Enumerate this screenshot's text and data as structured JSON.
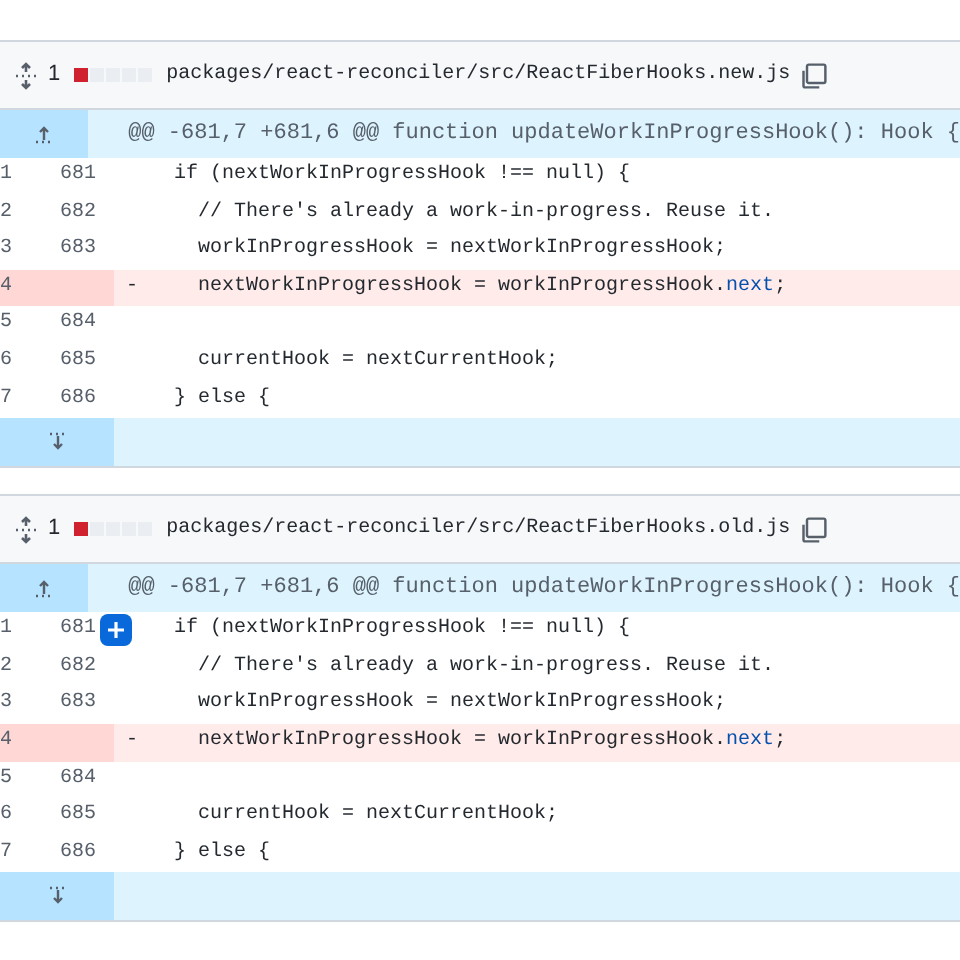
{
  "files": [
    {
      "count": "1",
      "diffstat": [
        {
          "kind": "deleted"
        },
        {
          "kind": "neutral"
        },
        {
          "kind": "neutral"
        },
        {
          "kind": "neutral"
        },
        {
          "kind": "neutral"
        }
      ],
      "path": "packages/react-reconciler/src/ReactFiberHooks.new.js",
      "hunk_header": "@@ -681,7 +681,6 @@ function updateWorkInProgressHook(): Hook {",
      "lines": [
        {
          "kind": "context",
          "old": "1",
          "new": "681",
          "segments": [
            {
              "kind": "plain",
              "text": "  if (nextWorkInProgressHook !== null) {"
            }
          ]
        },
        {
          "kind": "context",
          "old": "2",
          "new": "682",
          "segments": [
            {
              "kind": "plain",
              "text": "    // There's already a work-in-progress. Reuse it."
            }
          ]
        },
        {
          "kind": "context",
          "old": "3",
          "new": "683",
          "segments": [
            {
              "kind": "plain",
              "text": "    workInProgressHook = nextWorkInProgressHook;"
            }
          ]
        },
        {
          "kind": "deleted",
          "old": "4",
          "sign": "-",
          "segments": [
            {
              "kind": "plain",
              "text": "    nextWorkInProgressHook = workInProgressHook."
            },
            {
              "kind": "property",
              "text": "next"
            },
            {
              "kind": "plain",
              "text": ";"
            }
          ]
        },
        {
          "kind": "context",
          "old": "5",
          "new": "684"
        },
        {
          "kind": "context",
          "old": "6",
          "new": "685",
          "segments": [
            {
              "kind": "plain",
              "text": "    currentHook = nextCurrentHook;"
            }
          ]
        },
        {
          "kind": "context",
          "old": "7",
          "new": "686",
          "segments": [
            {
              "kind": "plain",
              "text": "  } else {"
            }
          ]
        }
      ]
    },
    {
      "count": "1",
      "diffstat": [
        {
          "kind": "deleted"
        },
        {
          "kind": "neutral"
        },
        {
          "kind": "neutral"
        },
        {
          "kind": "neutral"
        },
        {
          "kind": "neutral"
        }
      ],
      "path": "packages/react-reconciler/src/ReactFiberHooks.old.js",
      "hunk_header": "@@ -681,7 +681,6 @@ function updateWorkInProgressHook(): Hook {",
      "lines": [
        {
          "kind": "context",
          "old": "1",
          "new": "681",
          "comment_button": true,
          "segments": [
            {
              "kind": "plain",
              "text": "  if (nextWorkInProgressHook !== null) {"
            }
          ]
        },
        {
          "kind": "context",
          "old": "2",
          "new": "682",
          "segments": [
            {
              "kind": "plain",
              "text": "    // There's already a work-in-progress. Reuse it."
            }
          ]
        },
        {
          "kind": "context",
          "old": "3",
          "new": "683",
          "segments": [
            {
              "kind": "plain",
              "text": "    workInProgressHook = nextWorkInProgressHook;"
            }
          ]
        },
        {
          "kind": "deleted",
          "old": "4",
          "sign": "-",
          "segments": [
            {
              "kind": "plain",
              "text": "    nextWorkInProgressHook = workInProgressHook."
            },
            {
              "kind": "property",
              "text": "next"
            },
            {
              "kind": "plain",
              "text": ";"
            }
          ]
        },
        {
          "kind": "context",
          "old": "5",
          "new": "684"
        },
        {
          "kind": "context",
          "old": "6",
          "new": "685",
          "segments": [
            {
              "kind": "plain",
              "text": "    currentHook = nextCurrentHook;"
            }
          ]
        },
        {
          "kind": "context",
          "old": "7",
          "new": "686",
          "segments": [
            {
              "kind": "plain",
              "text": "  } else {"
            }
          ]
        }
      ]
    }
  ]
}
